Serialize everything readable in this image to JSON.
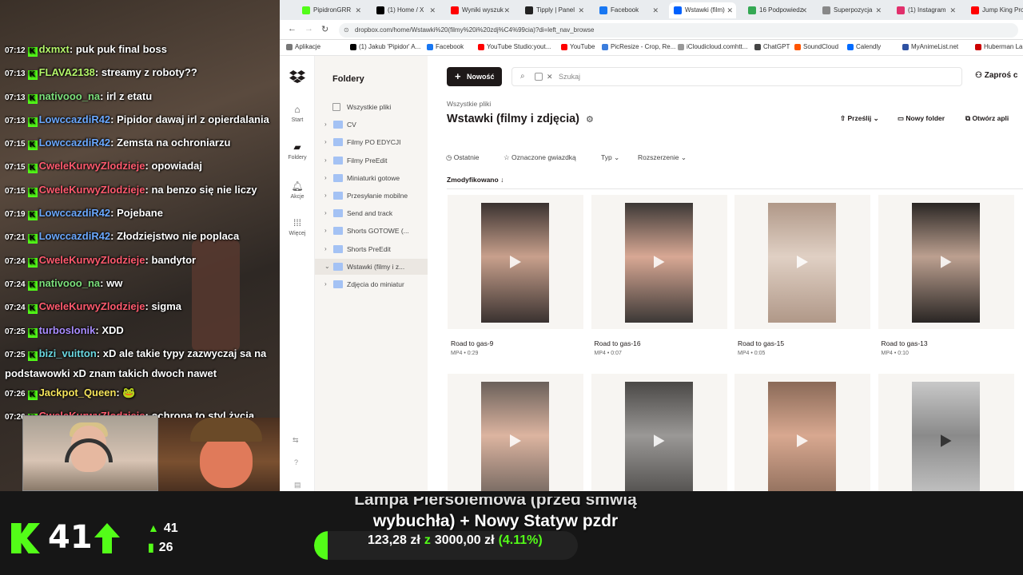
{
  "stream": {
    "chat": [
      {
        "time": "07:12",
        "user": "dxmxt",
        "color": "#b4f56a",
        "text": "puk puk final boss"
      },
      {
        "time": "07:13",
        "user": "FLAVA2138",
        "color": "#b4f56a",
        "text": "streamy z roboty??"
      },
      {
        "time": "07:13",
        "user": "nativooo_na",
        "color": "#7be07b",
        "text": "irl z etatu"
      },
      {
        "time": "07:13",
        "user": "LowccazdiR42",
        "color": "#6aa8ff",
        "text": "Pipidor dawaj irl z opierdalania"
      },
      {
        "time": "07:15",
        "user": "LowccazdiR42",
        "color": "#6aa8ff",
        "text": "Zemsta na ochroniarzu"
      },
      {
        "time": "07:15",
        "user": "CweleKurwyZlodzieje",
        "color": "#ff5a6e",
        "text": "opowiadaj"
      },
      {
        "time": "07:15",
        "user": "CweleKurwyZlodzieje",
        "color": "#ff5a6e",
        "text": "na benzo się nie liczy"
      },
      {
        "time": "07:19",
        "user": "LowccazdiR42",
        "color": "#6aa8ff",
        "text": "Pojebane"
      },
      {
        "time": "07:21",
        "user": "LowccazdiR42",
        "color": "#6aa8ff",
        "text": "Złodziejstwo nie poplaca"
      },
      {
        "time": "07:24",
        "user": "CweleKurwyZlodzieje",
        "color": "#ff5a6e",
        "text": "bandytor"
      },
      {
        "time": "07:24",
        "user": "nativooo_na",
        "color": "#7be07b",
        "text": "ww"
      },
      {
        "time": "07:24",
        "user": "CweleKurwyZlodzieje",
        "color": "#ff5a6e",
        "text": "sigma"
      },
      {
        "time": "07:25",
        "user": "turboslonik",
        "color": "#a98cff",
        "text": "XDD"
      },
      {
        "time": "07:25",
        "user": "bizi_vuitton",
        "color": "#6ad7e0",
        "text": "xD ale takie typy zazwyczaj sa na",
        "cont": "podstawowki xD znam takich dwoch nawet"
      },
      {
        "time": "07:26",
        "user": "Jackpot_Queen",
        "color": "#f5e35a",
        "text": "🐸"
      },
      {
        "time": "07:26",
        "user": "CweleKurwyZlodzieje",
        "color": "#ff5a6e",
        "text": "ochrona to styl życia"
      }
    ],
    "viewers": "41",
    "stat_a": "41",
    "stat_b": "26",
    "goal_title_line1": "Lampa Piersolemowa (przed śmwią",
    "goal_title_line2": "wybuchła) + Nowy Statyw pzdr",
    "goal_current": "123,28 zł",
    "goal_of": "z",
    "goal_target": "3000,00 zł",
    "goal_percent": "(4.11%)",
    "goal_fraction": 0.0411,
    "accent": "#53fc18"
  },
  "browser": {
    "tabs": [
      {
        "label": "PipidronGRR",
        "color": "#53fc18",
        "active": false
      },
      {
        "label": "(1) Home / X",
        "color": "#000000",
        "active": false
      },
      {
        "label": "Wyniki wyszuk",
        "color": "#ff0000",
        "active": false
      },
      {
        "label": "Tipply | Panel",
        "color": "#222222",
        "active": false
      },
      {
        "label": "Facebook",
        "color": "#1877f2",
        "active": false
      },
      {
        "label": "Wstawki (film)",
        "color": "#0061fe",
        "active": true
      },
      {
        "label": "16 Podpowiedz",
        "color": "#34a853",
        "active": false
      },
      {
        "label": "Superpozycja",
        "color": "#888888",
        "active": false
      },
      {
        "label": "(1) Instagram",
        "color": "#e1306c",
        "active": false
      },
      {
        "label": "Jump King Pro",
        "color": "#ff0000",
        "active": false
      }
    ],
    "url": "dropbox.com/home/Wstawki%20(filmy%20i%20zdj%C4%99cia)?di=left_nav_browse",
    "bookmarks": [
      {
        "label": "Aplikacje",
        "color": "#777777"
      },
      {
        "label": "(1) Jakub 'Pipidor' A...",
        "color": "#000000"
      },
      {
        "label": "Facebook",
        "color": "#1877f2"
      },
      {
        "label": "YouTube Studio:yout...",
        "color": "#ff0000"
      },
      {
        "label": "YouTube",
        "color": "#ff0000"
      },
      {
        "label": "PicResize - Crop, Re...",
        "color": "#3b7ddd"
      },
      {
        "label": "iCloudicloud.comhtt...",
        "color": "#999999"
      },
      {
        "label": "ChatGPT",
        "color": "#444444"
      },
      {
        "label": "SoundCloud",
        "color": "#ff5500"
      },
      {
        "label": "Calendly",
        "color": "#006bff"
      },
      {
        "label": "MyAnimeList.net",
        "color": "#2e51a2"
      },
      {
        "label": "Huberman Lab Fu...",
        "color": "#cc0000"
      }
    ]
  },
  "dropbox": {
    "rail": [
      {
        "label": "Start",
        "icon": "home-icon"
      },
      {
        "label": "Foldery",
        "icon": "folder-icon"
      },
      {
        "label": "Akcje",
        "icon": "bell-icon"
      },
      {
        "label": "Więcej",
        "icon": "grid-icon"
      }
    ],
    "tree_title": "Foldery",
    "tree": [
      {
        "label": "Wszystkie pliki",
        "chev": "",
        "kind": "plain"
      },
      {
        "label": "CV",
        "chev": "›",
        "kind": "blue"
      },
      {
        "label": "Filmy PO EDYCJI",
        "chev": "›",
        "kind": "blue"
      },
      {
        "label": "Filmy PreEdit",
        "chev": "›",
        "kind": "blue"
      },
      {
        "label": "Miniaturki gotowe",
        "chev": "›",
        "kind": "blue"
      },
      {
        "label": "Przesyłanie mobilne",
        "chev": "›",
        "kind": "blue"
      },
      {
        "label": "Send and track",
        "chev": "›",
        "kind": "blue"
      },
      {
        "label": "Shorts GOTOWE (...",
        "chev": "›",
        "kind": "blue"
      },
      {
        "label": "Shorts PreEdit",
        "chev": "›",
        "kind": "blue"
      },
      {
        "label": "Wstawki (filmy i z...",
        "chev": "⌄",
        "kind": "blue",
        "active": true
      },
      {
        "label": "Zdjęcia do miniatur",
        "chev": "›",
        "kind": "blue"
      }
    ],
    "new_label": "Nowość",
    "search_placeholder": "Szukaj",
    "invite_label": "Zaproś c",
    "breadcrumb": "Wszystkie pliki",
    "title": "Wstawki (filmy i zdjęcia)",
    "actions": [
      "Prześlij",
      "Nowy folder",
      "Otwórz apli"
    ],
    "filters": [
      "Ostatnie",
      "Oznaczone gwiazdką",
      "Typ",
      "Rozszerzenie"
    ],
    "sort_label": "Zmodyfikowano",
    "files": [
      {
        "name": "Road to gas-9",
        "meta": "MP4 • 0:29",
        "bg": "#3a3230",
        "skin": "#c8a08c"
      },
      {
        "name": "Road to gas-16",
        "meta": "MP4 • 0:07",
        "bg": "#3c3836",
        "skin": "#d8a894"
      },
      {
        "name": "Road to gas-15",
        "meta": "MP4 • 0:05",
        "bg": "#b09888",
        "skin": "#e0d0c4"
      },
      {
        "name": "Road to gas-13",
        "meta": "MP4 • 0:10",
        "bg": "#2a2624",
        "skin": "#bca090"
      },
      {
        "name": "",
        "meta": "",
        "bg": "#6a605a",
        "skin": "#dcb4a0"
      },
      {
        "name": "",
        "meta": "",
        "bg": "#4a4846",
        "skin": "#9a9896"
      },
      {
        "name": "",
        "meta": "",
        "bg": "#8a6a58",
        "skin": "#d8a890"
      },
      {
        "name": "",
        "meta": "",
        "bg": "#c8c8c8",
        "skin": "#8a8a8a"
      }
    ]
  }
}
